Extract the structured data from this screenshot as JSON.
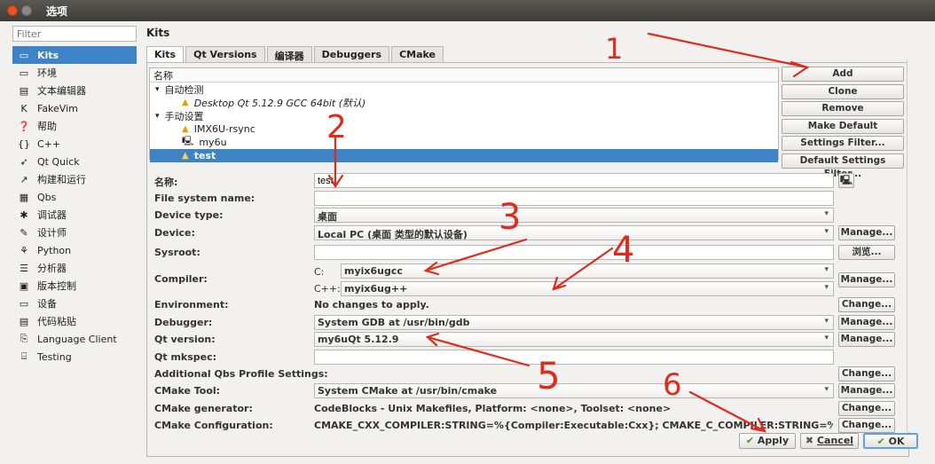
{
  "window": {
    "title": "选项"
  },
  "sidebar": {
    "filter_placeholder": "Filter",
    "items": [
      {
        "label": "Kits",
        "icon": "kits-icon",
        "glyph": "▭"
      },
      {
        "label": "环境",
        "icon": "monitor-icon",
        "glyph": "▭"
      },
      {
        "label": "文本编辑器",
        "icon": "text-editor-icon",
        "glyph": "▤"
      },
      {
        "label": "FakeVim",
        "icon": "fakevim-icon",
        "glyph": "K"
      },
      {
        "label": "帮助",
        "icon": "help-icon",
        "glyph": "❓"
      },
      {
        "label": "C++",
        "icon": "cpp-icon",
        "glyph": "{}"
      },
      {
        "label": "Qt Quick",
        "icon": "qt-quick-icon",
        "glyph": "➶"
      },
      {
        "label": "构建和运行",
        "icon": "build-run-icon",
        "glyph": "↗"
      },
      {
        "label": "Qbs",
        "icon": "qbs-icon",
        "glyph": "▦"
      },
      {
        "label": "调试器",
        "icon": "debugger-icon",
        "glyph": "✱"
      },
      {
        "label": "设计师",
        "icon": "designer-icon",
        "glyph": "✎"
      },
      {
        "label": "Python",
        "icon": "python-icon",
        "glyph": "⚘"
      },
      {
        "label": "分析器",
        "icon": "analyzer-icon",
        "glyph": "☰"
      },
      {
        "label": "版本控制",
        "icon": "version-control-icon",
        "glyph": "▣"
      },
      {
        "label": "设备",
        "icon": "devices-icon",
        "glyph": "▭"
      },
      {
        "label": "代码粘贴",
        "icon": "code-paste-icon",
        "glyph": "▤"
      },
      {
        "label": "Language Client",
        "icon": "language-client-icon",
        "glyph": "⎘"
      },
      {
        "label": "Testing",
        "icon": "testing-icon",
        "glyph": "⌸"
      }
    ]
  },
  "main": {
    "title": "Kits",
    "tabs": [
      "Kits",
      "Qt Versions",
      "编译器",
      "Debuggers",
      "CMake"
    ],
    "tree": {
      "header": "名称",
      "rows": [
        {
          "label": "自动检测",
          "italic": false
        },
        {
          "label": "Desktop Qt 5.12.9 GCC 64bit (默认)",
          "italic": true
        },
        {
          "label": "手动设置",
          "italic": false
        },
        {
          "label": "IMX6U-rsync",
          "italic": false
        },
        {
          "label": "my6u",
          "italic": false
        },
        {
          "label": "test",
          "italic": false
        }
      ],
      "expand_glyph": "▾",
      "warn_glyph": "▲",
      "device_glyph": "🖳"
    },
    "buttons": {
      "add": "Add",
      "clone": "Clone",
      "remove": "Remove",
      "make_default": "Make Default",
      "settings_filter": "Settings Filter...",
      "default_settings_filter": "Default Settings Filter..."
    },
    "form": {
      "name_label": "名称:",
      "name_value": "test",
      "fsname_label": "File system name:",
      "fsname_value": "",
      "device_type_label": "Device type:",
      "device_type_value": "桌面",
      "device_label": "Device:",
      "device_value": "Local PC (桌面 类型的默认设备)",
      "sysroot_label": "Sysroot:",
      "sysroot_value": "",
      "compiler_label": "Compiler:",
      "c_label": "C:",
      "c_value": "myix6ugcc",
      "cpp_label": "C++:",
      "cpp_value": "myix6ug++",
      "environment_label": "Environment:",
      "environment_value": "No changes to apply.",
      "debugger_label": "Debugger:",
      "debugger_value": "System GDB at /usr/bin/gdb",
      "qt_version_label": "Qt version:",
      "qt_version_value": "my6uQt 5.12.9",
      "qt_mkspec_label": "Qt mkspec:",
      "qt_mkspec_value": "",
      "qbs_label": "Additional Qbs Profile Settings:",
      "cmake_tool_label": "CMake Tool:",
      "cmake_tool_value": "System CMake at /usr/bin/cmake",
      "cmake_gen_label": "CMake generator:",
      "cmake_gen_value": "CodeBlocks - Unix Makefiles, Platform: <none>, Toolset: <none>",
      "cmake_conf_label": "CMake Configuration:",
      "cmake_conf_value": "CMAKE_CXX_COMPILER:STRING=%{Compiler:Executable:Cxx}; CMAKE_C_COMPILER:STRING=%{Compil..."
    },
    "side_buttons": {
      "manage": "Manage...",
      "browse": "浏览...",
      "change": "Change..."
    }
  },
  "dialog": {
    "apply": "Apply",
    "cancel": "Cancel",
    "ok": "OK"
  },
  "annotations": [
    "1",
    "2",
    "3",
    "4",
    "5",
    "6"
  ],
  "colors": {
    "selection": "#3d83c6",
    "annotation": "#e02b1c",
    "warning": "#e8a000"
  }
}
